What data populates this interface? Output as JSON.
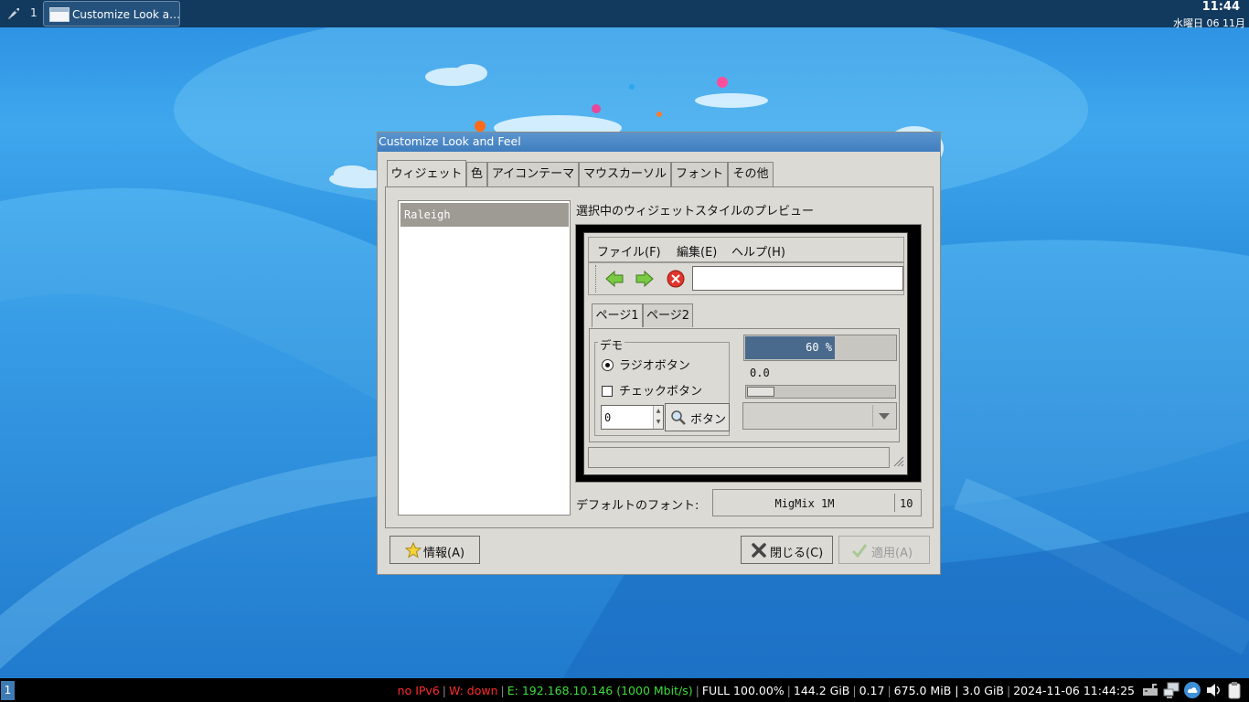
{
  "top_panel": {
    "workspace_number": "1",
    "task_label": "Customize Look a…",
    "clock_time": "11:44",
    "clock_date": "水曜日 06 11月"
  },
  "dialog": {
    "title": "Customize Look and Feel",
    "tabs": [
      {
        "label": "ウィジェット"
      },
      {
        "label": "色"
      },
      {
        "label": "アイコンテーマ"
      },
      {
        "label": "マウスカーソル"
      },
      {
        "label": "フォント"
      },
      {
        "label": "その他"
      }
    ],
    "theme_list": [
      "Raleigh"
    ],
    "preview_title": "選択中のウィジェットスタイルのプレビュー",
    "preview": {
      "menu": [
        "ファイル(F)",
        "編集(E)",
        "ヘルプ(H)"
      ],
      "toolbar_entry_value": "",
      "inner_tabs": [
        "ページ1",
        "ページ2"
      ],
      "demo_label": "デモ",
      "radio_label": "ラジオボタン",
      "radio_checked": true,
      "check_label": "チェックボタン",
      "check_checked": false,
      "spin_value": "0",
      "button_label": "ボタン",
      "progress_percent": 60,
      "progress_text": "60 %",
      "scale_value": "0.0",
      "scale_level": 0,
      "combo_value": ""
    },
    "default_font_label": "デフォルトのフォント:",
    "default_font_name": "MigMix 1M",
    "default_font_size": "10",
    "buttons": {
      "about": "情報(A)",
      "close": "閉じる(C)",
      "apply": "適用(A)"
    }
  },
  "status_bar": {
    "workspace": "1",
    "ipv6": "no IPv6",
    "wifi": "W: down",
    "ethernet": "E: 192.168.10.146 (1000 Mbit/s)",
    "battery": "FULL 100.00%",
    "disk": "144.2 GiB",
    "load": "0.17",
    "memory": "675.0 MiB | 3.0 GiB",
    "datetime": "2024-11-06 11:44:25"
  },
  "colors": {
    "panel": "#123a5f",
    "titlebar": "#4a88c6",
    "dialog_bg": "#dcdad5",
    "progress_fill": "#4a6a8d",
    "status_red": "#ff2a2a",
    "status_green": "#3cdc3c"
  }
}
